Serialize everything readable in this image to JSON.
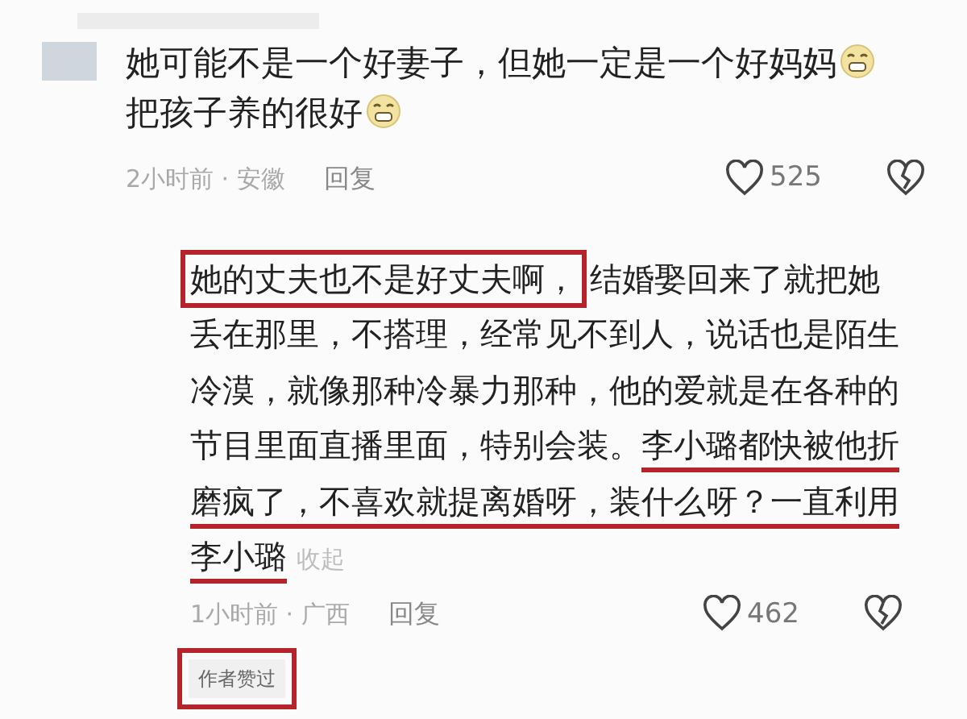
{
  "comment": {
    "lines": [
      "她可能不是一个好妻子，但她一定是一个好妈妈",
      "把孩子养的很好"
    ],
    "meta": "2小时前 · 安徽",
    "reply_label": "回复",
    "likes": "525"
  },
  "reply": {
    "segments": [
      {
        "text": "她的丈夫也不是好丈夫啊，",
        "boxed": true,
        "underlined": false
      },
      {
        "text": "结婚娶回来了就把她丢在那里，不搭理，经常见不到人，说话也是陌生冷漠，就像那种冷暴力那种，他的爱就是在各种的节目里面直播里面，特别会装。",
        "boxed": false,
        "underlined": false
      },
      {
        "text": "李小璐都快被他折磨疯了，不喜欢就提离婚呀，装什么呀？一直利用李小璐",
        "boxed": false,
        "underlined": true
      }
    ],
    "collapse_label": "收起",
    "meta": "1小时前 · 广西",
    "reply_label": "回复",
    "likes": "462",
    "badge": {
      "text": "作者赞过",
      "boxed": true
    }
  }
}
